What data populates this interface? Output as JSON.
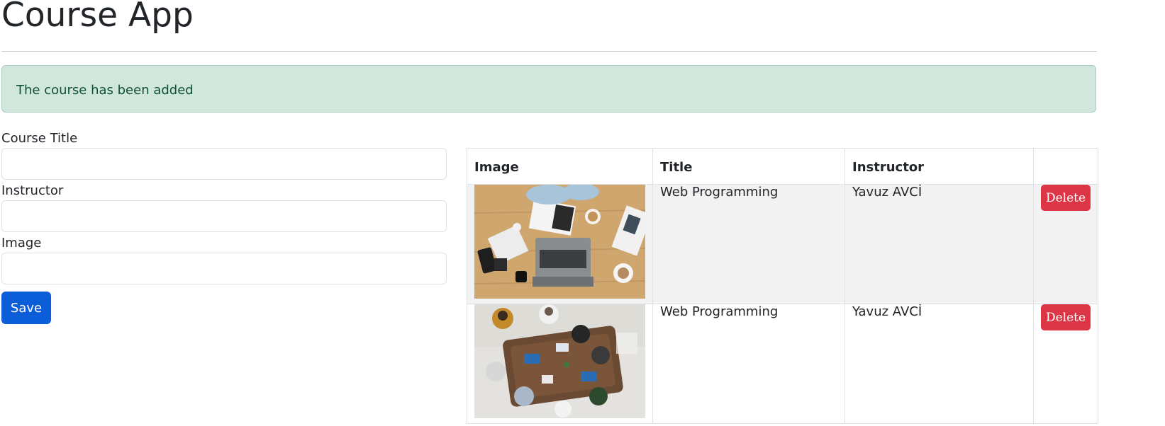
{
  "app": {
    "title": "Course App"
  },
  "alert": {
    "message": "The course has been added",
    "background": "#d1e7dd",
    "text_color": "#0f5132"
  },
  "form": {
    "fields": [
      {
        "label": "Course Title",
        "value": "",
        "placeholder": ""
      },
      {
        "label": "Instructor",
        "value": "",
        "placeholder": ""
      },
      {
        "label": "Image",
        "value": "",
        "placeholder": ""
      }
    ],
    "save_label": "Save",
    "save_color": "#0b5ed7"
  },
  "table": {
    "headers": [
      "Image",
      "Title",
      "Instructor",
      ""
    ],
    "rows": [
      {
        "image": "laptop-desk-photo",
        "title": "Web Programming",
        "instructor": "Yavuz AVCİ",
        "action": "Delete"
      },
      {
        "image": "team-meeting-photo",
        "title": "Web Programming",
        "instructor": "Yavuz AVCİ",
        "action": "Delete"
      }
    ],
    "delete_color": "#dc3545"
  }
}
